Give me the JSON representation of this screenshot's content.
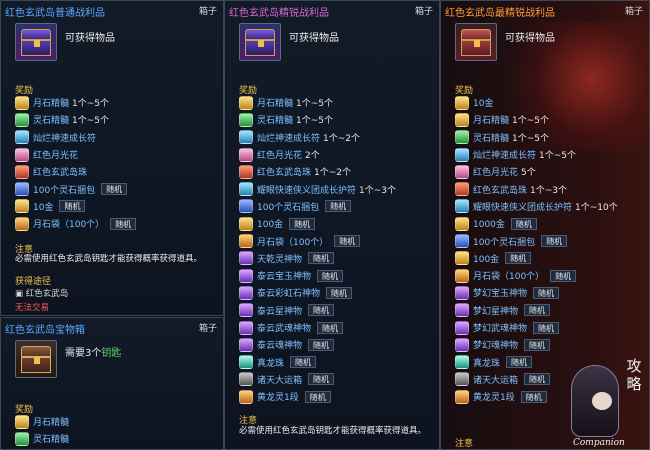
{
  "panels": [
    {
      "title": "红色玄武岛普通战利品",
      "title_color": "#5aa8ff",
      "tag": "箱子",
      "obtain_label": "可获得物品",
      "reward_header": "奖励",
      "items": [
        {
          "icon": "moonstone-essence-icon",
          "name": "月石精髓",
          "qty": "1个~5个",
          "random": ""
        },
        {
          "icon": "spirit-stone-essence-icon",
          "name": "灵石精髓",
          "qty": "1个~5个",
          "random": ""
        },
        {
          "icon": "talisman-icon",
          "name": "灿烂神速成长符",
          "qty": "",
          "random": ""
        },
        {
          "icon": "flower-icon",
          "name": "红色月光花",
          "qty": "",
          "random": ""
        },
        {
          "icon": "red-bead-icon",
          "name": "红色玄武岛珠",
          "qty": "",
          "random": ""
        },
        {
          "icon": "pouch-icon",
          "name": "100个灵石捆包",
          "qty": "",
          "random": "随机"
        },
        {
          "icon": "gold-icon",
          "name": "10金",
          "qty": "",
          "random": "随机"
        },
        {
          "icon": "money-bag-icon",
          "name": "月石袋（100个）",
          "qty": "",
          "random": "随机"
        }
      ],
      "note_header": "注意",
      "note": "必需使用红色玄武岛钥匙才能获得概率获得道具。",
      "route_header": "获得途径",
      "route": "红色玄武岛",
      "warning": "无法交易"
    },
    {
      "title": "红色玄武岛精锐战利品",
      "title_color": "#d86ad8",
      "tag": "箱子",
      "obtain_label": "可获得物品",
      "reward_header": "奖励",
      "items": [
        {
          "icon": "moonstone-essence-icon",
          "name": "月石精髓",
          "qty": "1个~5个",
          "random": ""
        },
        {
          "icon": "spirit-stone-essence-icon",
          "name": "灵石精髓",
          "qty": "1个~5个",
          "random": ""
        },
        {
          "icon": "talisman-icon",
          "name": "灿烂神速成长符",
          "qty": "1个~2个",
          "random": ""
        },
        {
          "icon": "flower-icon",
          "name": "红色月光花",
          "qty": "2个",
          "random": ""
        },
        {
          "icon": "red-bead-icon",
          "name": "红色玄武岛珠",
          "qty": "1个~2个",
          "random": ""
        },
        {
          "icon": "talisman-icon",
          "name": "耀眼快速侠义团成长护符",
          "qty": "1个~3个",
          "random": ""
        },
        {
          "icon": "pouch-icon",
          "name": "100个灵石捆包",
          "qty": "",
          "random": "随机"
        },
        {
          "icon": "gold-icon",
          "name": "100金",
          "qty": "",
          "random": "随机"
        },
        {
          "icon": "money-bag-icon",
          "name": "月石袋（100个）",
          "qty": "",
          "random": "随机"
        },
        {
          "icon": "gem-icon",
          "name": "天乾灵神物",
          "qty": "",
          "random": "随机"
        },
        {
          "icon": "gem-icon",
          "name": "泰云宝玉神物",
          "qty": "",
          "random": "随机"
        },
        {
          "icon": "gem-icon",
          "name": "泰云彩虹石神物",
          "qty": "",
          "random": "随机"
        },
        {
          "icon": "gem-icon",
          "name": "泰云星神物",
          "qty": "",
          "random": "随机"
        },
        {
          "icon": "gem-icon",
          "name": "泰云武魂神物",
          "qty": "",
          "random": "随机"
        },
        {
          "icon": "gem-icon",
          "name": "泰云魂神物",
          "qty": "",
          "random": "随机"
        },
        {
          "icon": "bead-icon",
          "name": "真龙珠",
          "qty": "",
          "random": "随机"
        },
        {
          "icon": "scroll-icon",
          "name": "诸天大运箱",
          "qty": "",
          "random": "随机"
        },
        {
          "icon": "orb-icon",
          "name": "黄龙灵1段",
          "qty": "",
          "random": "随机"
        }
      ],
      "note_header": "注意",
      "note": "必需使用红色玄武岛钥匙才能获得概率获得道具。"
    },
    {
      "title": "红色玄武岛最精锐战利品",
      "title_color": "#ff9a3c",
      "tag": "箱子",
      "obtain_label": "可获得物品",
      "reward_header": "奖励",
      "items": [
        {
          "icon": "gold-icon",
          "name": "10金",
          "qty": "",
          "random": ""
        },
        {
          "icon": "moonstone-essence-icon",
          "name": "月石精髓",
          "qty": "1个~5个",
          "random": ""
        },
        {
          "icon": "spirit-stone-essence-icon",
          "name": "灵石精髓",
          "qty": "1个~5个",
          "random": ""
        },
        {
          "icon": "talisman-icon",
          "name": "灿烂神速成长符",
          "qty": "1个~5个",
          "random": ""
        },
        {
          "icon": "flower-icon",
          "name": "红色月光花",
          "qty": "5个",
          "random": ""
        },
        {
          "icon": "red-bead-icon",
          "name": "红色玄武岛珠",
          "qty": "1个~3个",
          "random": ""
        },
        {
          "icon": "talisman-icon",
          "name": "耀眼快速侠义团成长护符",
          "qty": "1个~10个",
          "random": ""
        },
        {
          "icon": "gold-icon",
          "name": "1000金",
          "qty": "",
          "random": "随机"
        },
        {
          "icon": "pouch-icon",
          "name": "100个灵石捆包",
          "qty": "",
          "random": "随机"
        },
        {
          "icon": "gold-icon",
          "name": "100金",
          "qty": "",
          "random": "随机"
        },
        {
          "icon": "money-bag-icon",
          "name": "月石袋（100个）",
          "qty": "",
          "random": "随机"
        },
        {
          "icon": "gem-icon",
          "name": "梦幻宝玉神物",
          "qty": "",
          "random": "随机"
        },
        {
          "icon": "gem-icon",
          "name": "梦幻星神物",
          "qty": "",
          "random": "随机"
        },
        {
          "icon": "gem-icon",
          "name": "梦幻武魂神物",
          "qty": "",
          "random": "随机"
        },
        {
          "icon": "gem-icon",
          "name": "梦幻魂神物",
          "qty": "",
          "random": "随机"
        },
        {
          "icon": "bead-icon",
          "name": "真龙珠",
          "qty": "",
          "random": "随机"
        },
        {
          "icon": "scroll-icon",
          "name": "诸天大运箱",
          "qty": "",
          "random": "随机"
        },
        {
          "icon": "orb-icon",
          "name": "黄龙灵1段",
          "qty": "",
          "random": "随机"
        }
      ],
      "note_header": "注意"
    },
    {
      "title": "红色玄武岛宝物箱",
      "title_color": "#5aa8ff",
      "tag": "箱子",
      "need_prefix": "需要3个",
      "need_key": "钥匙",
      "reward_header": "奖励",
      "items": [
        {
          "icon": "moonstone-essence-icon",
          "name": "月石精髓",
          "qty": "",
          "random": ""
        },
        {
          "icon": "spirit-stone-essence-icon",
          "name": "灵石精髓",
          "qty": "",
          "random": ""
        }
      ]
    }
  ],
  "watermark": {
    "calligraphy": "攻略",
    "caption": "Companion"
  }
}
